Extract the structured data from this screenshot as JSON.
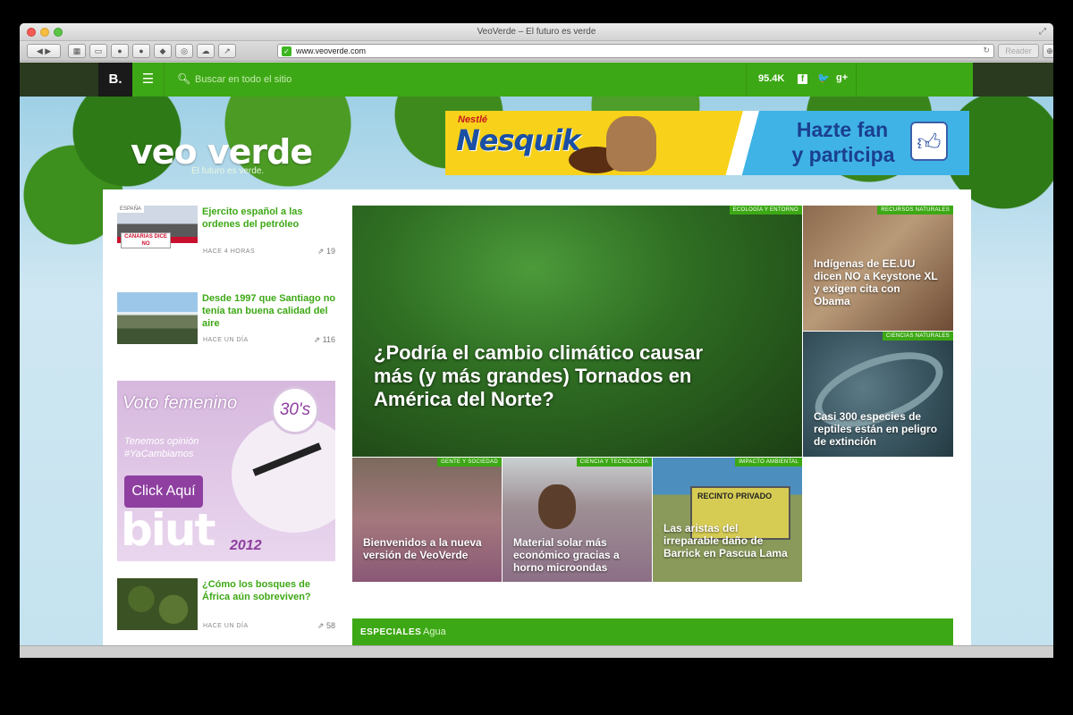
{
  "browser": {
    "window_title": "VeoVerde – El futuro es verde",
    "url": "www.veoverde.com",
    "reader_label": "Reader",
    "favicon": "✓"
  },
  "site_nav": {
    "logo": "B.",
    "menu_icon": "hamburger-icon",
    "search_placeholder": "Buscar en todo el sitio",
    "follower_count": "95.4K",
    "social_icons": [
      "facebook-icon",
      "twitter-icon",
      "google-plus-icon"
    ],
    "facebook_glyph": "f",
    "twitter_glyph": "🐦",
    "google_glyph": "g+"
  },
  "brand": {
    "name": "veo verde",
    "tagline": "El futuro es verde."
  },
  "ad_banner": {
    "brand_small": "Nestlé",
    "brand": "Nesquik",
    "cta_line1": "Hazte fan",
    "cta_line2": "y participa",
    "icon": "thumbs-up-icon"
  },
  "sidebar": {
    "items": [
      {
        "tag": "ESPAÑA",
        "thumb_text": "CANARIAS DICE NO",
        "title": "Ejercito español a las ordenes del petróleo",
        "meta": "HACE 4 HORAS",
        "shares": "19"
      },
      {
        "tag": "",
        "title": "Desde 1997 que Santiago no tenía tan buena calidad del aire",
        "meta": "HACE UN DÍA",
        "shares": "116"
      },
      {
        "tag": "",
        "title": "¿Cómo los bosques de África aún sobreviven?",
        "meta": "HACE UN DÍA",
        "shares": "58"
      }
    ],
    "ad": {
      "title": "Voto femenino",
      "badge": "30's",
      "subtitle_1": "Tenemos opinión",
      "subtitle_2": "#YaCambiamos",
      "button": "Click Aquí",
      "brand": "biut",
      "year": "2012"
    }
  },
  "featured": {
    "main": {
      "tag": "ECOLOGÍA Y ENTORNO",
      "title": "¿Podría el cambio climático causar más (y más grandes) Tornados en América del Norte?"
    },
    "side_tiles": [
      {
        "tag": "RECURSOS NATURALES",
        "title": "Indígenas de EE.UU dicen NO a Keystone XL y exigen cita con Obama"
      },
      {
        "tag": "CIENCIAS NATURALES",
        "title": "Casi 300 especies de reptiles están en peligro de extinción"
      }
    ],
    "bottom_tiles": [
      {
        "tag": "GENTE Y SOCIEDAD",
        "title": "Bienvenidos a la nueva versión de VeoVerde"
      },
      {
        "tag": "CIENCIA Y TECNOLOGÍA",
        "title": "Material solar más económico gracias a horno microondas"
      },
      {
        "tag": "IMPACTO AMBIENTAL",
        "title": "Las aristas del irreparable daño de Barrick en Pascua Lama",
        "sign_text": "RECINTO PRIVADO"
      }
    ]
  },
  "especiales": {
    "label": "ESPECIALES",
    "value": "Agua"
  },
  "colors": {
    "brand_green": "#3da815",
    "dark": "#1a1a1a",
    "ad_purple": "#8e3fa0"
  }
}
